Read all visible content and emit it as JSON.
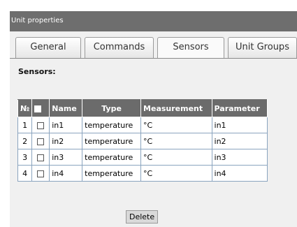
{
  "window": {
    "title": "Unit properties"
  },
  "tabs": [
    {
      "label": "General"
    },
    {
      "label": "Commands"
    },
    {
      "label": "Sensors",
      "active": true
    },
    {
      "label": "Unit Groups"
    }
  ],
  "sensors": {
    "title": "Sensors:",
    "columns": {
      "no": "№",
      "name": "Name",
      "type": "Type",
      "measurement": "Measurement",
      "parameter": "Parameter"
    },
    "rows": [
      {
        "no": "1",
        "name": "in1",
        "type": "temperature",
        "measurement": "°C",
        "parameter": "in1",
        "checked": false
      },
      {
        "no": "2",
        "name": "in2",
        "type": "temperature",
        "measurement": "°C",
        "parameter": "in2",
        "checked": false
      },
      {
        "no": "3",
        "name": "in3",
        "type": "temperature",
        "measurement": "°C",
        "parameter": "in3",
        "checked": false
      },
      {
        "no": "4",
        "name": "in4",
        "type": "temperature",
        "measurement": "°C",
        "parameter": "in4",
        "checked": false
      }
    ],
    "delete_label": "Delete"
  },
  "colors": {
    "titlebar": "#6e6e6e",
    "header": "#6b6b6b",
    "panel": "#f0f0f0",
    "grid_border": "#8aa4bf"
  }
}
